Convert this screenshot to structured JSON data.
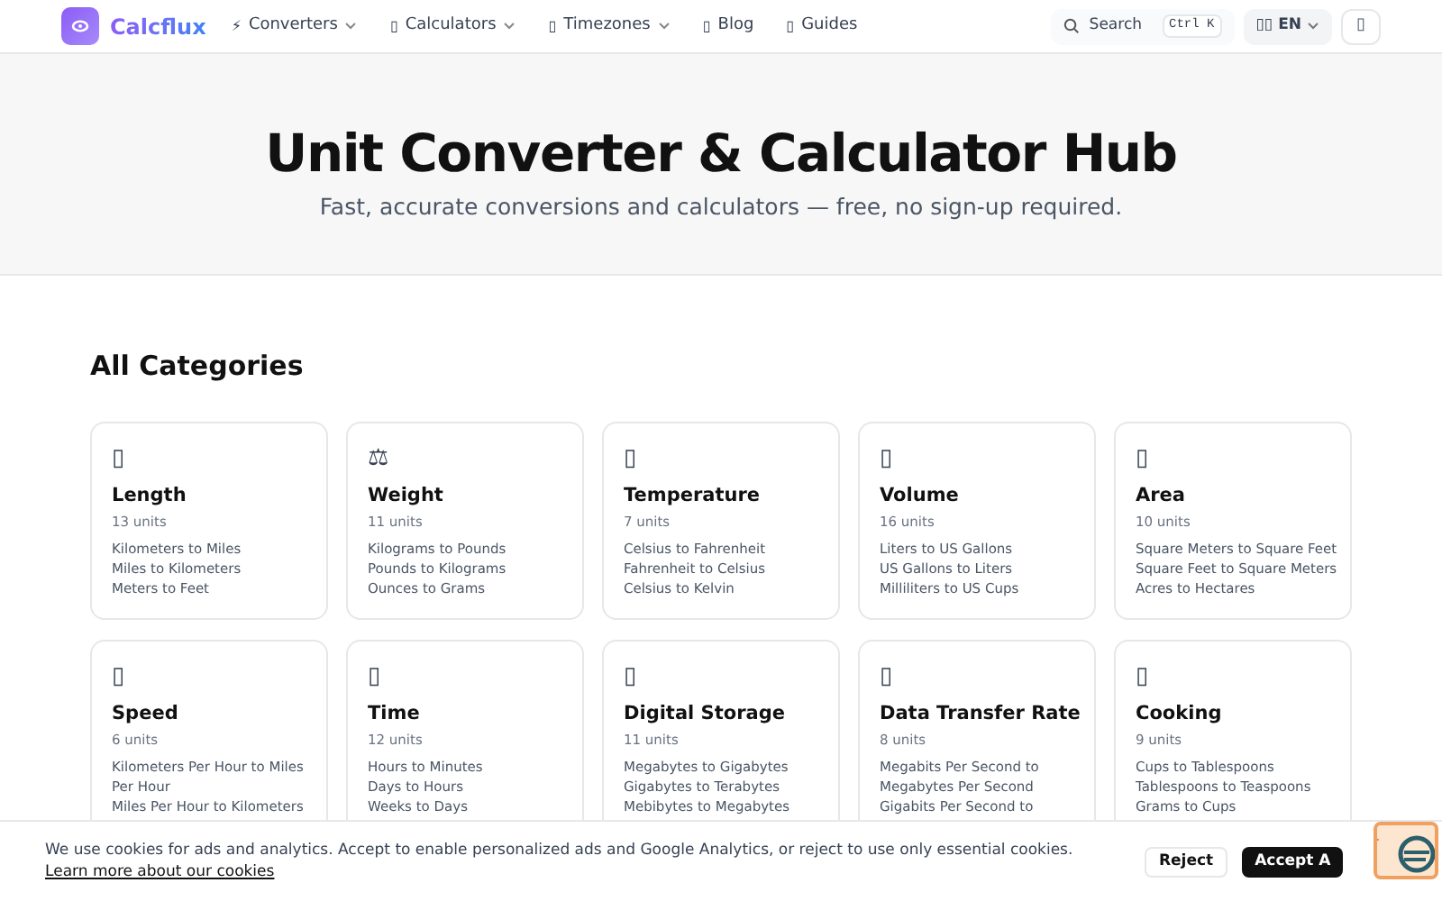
{
  "header": {
    "logo": "Calcflux",
    "nav": [
      {
        "icon": "⚡",
        "label": "Converters",
        "dropdown": true
      },
      {
        "icon": "▯",
        "label": "Calculators",
        "dropdown": true
      },
      {
        "icon": "▯",
        "label": "Timezones",
        "dropdown": true
      },
      {
        "icon": "▯",
        "label": "Blog",
        "dropdown": false
      },
      {
        "icon": "▯",
        "label": "Guides",
        "dropdown": false
      }
    ],
    "search": {
      "label": "Search",
      "shortcut": "Ctrl K"
    },
    "language": {
      "icon": "▯▯",
      "label": "EN"
    },
    "theme_icon": "▯"
  },
  "hero": {
    "title": "Unit Converter & Calculator Hub",
    "subtitle": "Fast, accurate conversions and calculators — free, no sign-up required."
  },
  "categories_heading": "All Categories",
  "categories": [
    {
      "icon": "▯",
      "title": "Length",
      "units": "13 units",
      "links": [
        "Kilometers to Miles",
        "Miles to Kilometers",
        "Meters to Feet"
      ]
    },
    {
      "icon": "⚖",
      "title": "Weight",
      "units": "11 units",
      "links": [
        "Kilograms to Pounds",
        "Pounds to Kilograms",
        "Ounces to Grams"
      ]
    },
    {
      "icon": "▯",
      "title": "Temperature",
      "units": "7 units",
      "links": [
        "Celsius to Fahrenheit",
        "Fahrenheit to Celsius",
        "Celsius to Kelvin"
      ]
    },
    {
      "icon": "▯",
      "title": "Volume",
      "units": "16 units",
      "links": [
        "Liters to US Gallons",
        "US Gallons to Liters",
        "Milliliters to US Cups"
      ]
    },
    {
      "icon": "▯",
      "title": "Area",
      "units": "10 units",
      "links": [
        "Square Meters to Square Feet",
        "Square Feet to Square Meters",
        "Acres to Hectares"
      ]
    },
    {
      "icon": "▯",
      "title": "Speed",
      "units": "6 units",
      "links": [
        "Kilometers Per Hour to Miles Per Hour",
        "Miles Per Hour to Kilometers"
      ]
    },
    {
      "icon": "▯",
      "title": "Time",
      "units": "12 units",
      "links": [
        "Hours to Minutes",
        "Days to Hours",
        "Weeks to Days"
      ]
    },
    {
      "icon": "▯",
      "title": "Digital Storage",
      "units": "11 units",
      "links": [
        "Megabytes to Gigabytes",
        "Gigabytes to Terabytes",
        "Mebibytes to Megabytes"
      ]
    },
    {
      "icon": "▯",
      "title": "Data Transfer Rate",
      "units": "8 units",
      "links": [
        "Megabits Per Second to Megabytes Per Second",
        "Gigabits Per Second to"
      ]
    },
    {
      "icon": "▯",
      "title": "Cooking",
      "units": "9 units",
      "links": [
        "Cups to Tablespoons",
        "Tablespoons to Teaspoons",
        "Grams to Cups"
      ]
    }
  ],
  "cookie_banner": {
    "text": "We use cookies for ads and analytics. Accept to enable personalized ads and Google Analytics, or reject to use only essential cookies.",
    "link": "Learn more about our cookies",
    "buttons": [
      {
        "label": "Reject",
        "kind": "secondary"
      },
      {
        "label": "Accept A",
        "kind": "primary"
      }
    ]
  }
}
